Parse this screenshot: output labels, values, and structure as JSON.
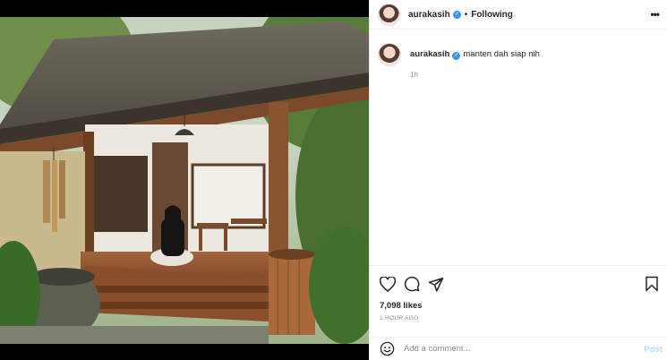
{
  "post": {
    "username": "aurakasih",
    "follow_status": "Following",
    "separator": "•",
    "caption": "manten dah siap nih",
    "caption_time": "1h",
    "likes": "7,098 likes",
    "posted_time": "1 HOUR AGO",
    "comment_placeholder": "Add a comment...",
    "post_button": "Post",
    "verified_mark": "✓",
    "more_menu": "•••"
  },
  "icons": {
    "verified": "verified-badge-icon",
    "like": "heart-icon",
    "comment": "comment-icon",
    "share": "paper-plane-icon",
    "save": "bookmark-icon",
    "emoji": "smiley-icon",
    "more": "more-options-icon"
  },
  "colors": {
    "verified_blue": "#3897f0",
    "post_button_disabled": "#b3dbff",
    "secondary_text": "#8e8e8e",
    "primary_text": "#262626"
  }
}
